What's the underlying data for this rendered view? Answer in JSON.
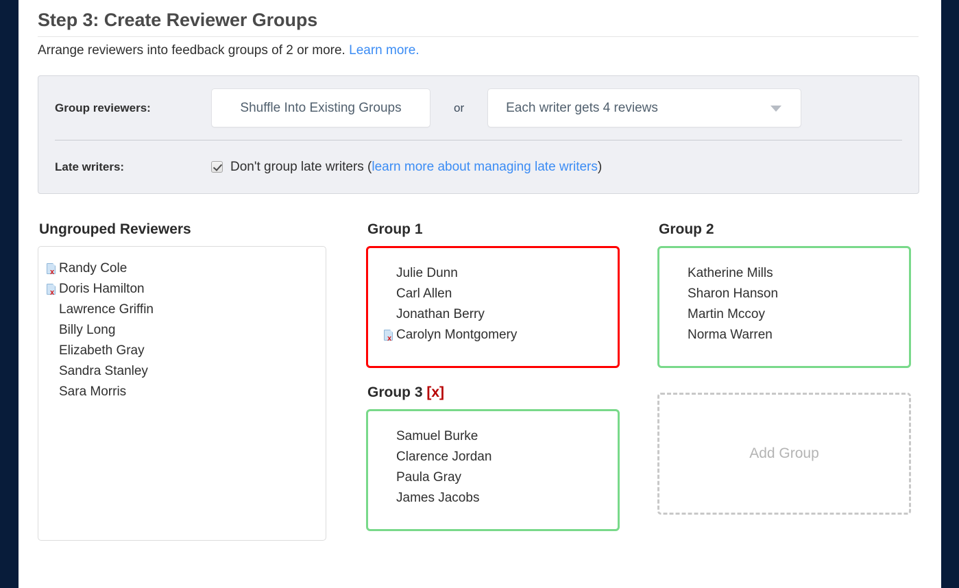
{
  "header": {
    "title": "Step 3: Create Reviewer Groups",
    "subtitle_text": "Arrange reviewers into feedback groups of 2 or more.",
    "subtitle_link": "Learn more."
  },
  "options": {
    "group_reviewers_label": "Group reviewers:",
    "shuffle_button": "Shuffle Into Existing Groups",
    "or": "or",
    "reviews_select_value": "Each writer gets 4 reviews",
    "late_writers_label": "Late writers:",
    "late_checkbox_checked": true,
    "late_text_before": "Don't group late writers (",
    "late_link": "learn more about managing late writers",
    "late_text_after": ")"
  },
  "ungrouped": {
    "heading": "Ungrouped Reviewers",
    "members": [
      {
        "name": "Randy Cole",
        "late": true
      },
      {
        "name": "Doris Hamilton",
        "late": true
      },
      {
        "name": "Lawrence Griffin",
        "late": false
      },
      {
        "name": "Billy Long",
        "late": false
      },
      {
        "name": "Elizabeth Gray",
        "late": false
      },
      {
        "name": "Sandra Stanley",
        "late": false
      },
      {
        "name": "Sara Morris",
        "late": false
      }
    ]
  },
  "groups": [
    {
      "heading": "Group 1",
      "delete_label": "",
      "status": "invalid",
      "border_color": "#ff0000",
      "members": [
        {
          "name": "Julie Dunn",
          "late": false
        },
        {
          "name": "Carl Allen",
          "late": false
        },
        {
          "name": "Jonathan Berry",
          "late": false
        },
        {
          "name": "Carolyn Montgomery",
          "late": true
        }
      ]
    },
    {
      "heading": "Group 2",
      "delete_label": "",
      "status": "valid",
      "border_color": "#79d98a",
      "members": [
        {
          "name": "Katherine Mills",
          "late": false
        },
        {
          "name": "Sharon Hanson",
          "late": false
        },
        {
          "name": "Martin Mccoy",
          "late": false
        },
        {
          "name": "Norma Warren",
          "late": false
        }
      ]
    },
    {
      "heading": "Group 3",
      "delete_label": "[x]",
      "status": "valid",
      "border_color": "#79d98a",
      "members": [
        {
          "name": "Samuel Burke",
          "late": false
        },
        {
          "name": "Clarence Jordan",
          "late": false
        },
        {
          "name": "Paula Gray",
          "late": false
        },
        {
          "name": "James Jacobs",
          "late": false
        }
      ]
    }
  ],
  "add_group": {
    "label": "Add Group"
  },
  "colors": {
    "valid_border": "#79d98a",
    "invalid_border": "#ff0000",
    "link": "#3b8cf4",
    "delete_link": "#b70000",
    "edge_bar": "#081c3a",
    "panel_bg": "#eff0f4"
  },
  "icons": {
    "late_writer": "late-writer-document-x-icon",
    "select_caret": "chevron-down-icon"
  }
}
